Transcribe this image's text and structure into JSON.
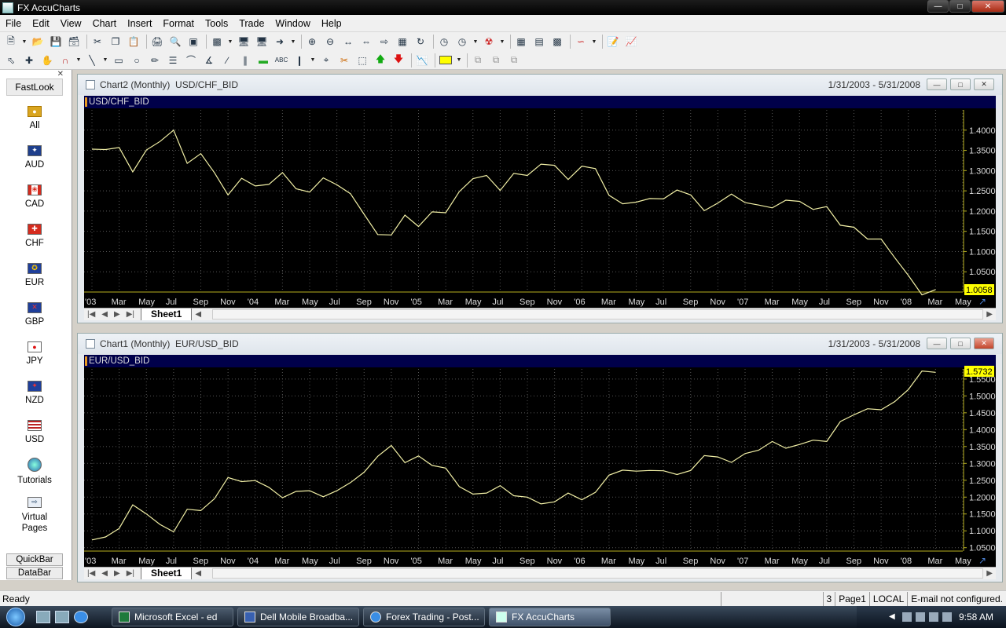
{
  "window": {
    "title": "FX AccuCharts"
  },
  "menu": [
    "File",
    "Edit",
    "View",
    "Chart",
    "Insert",
    "Format",
    "Tools",
    "Trade",
    "Window",
    "Help"
  ],
  "sidebar": {
    "title": "FastLook",
    "items": [
      {
        "label": "All",
        "icon": "coins-icon",
        "color": "#d9a520"
      },
      {
        "label": "AUD",
        "icon": "flag-aud-icon",
        "color": "#1e3f8c"
      },
      {
        "label": "CAD",
        "icon": "flag-cad-icon",
        "color": "#d52b1e"
      },
      {
        "label": "CHF",
        "icon": "flag-chf-icon",
        "color": "#d52b1e"
      },
      {
        "label": "EUR",
        "icon": "flag-eur-icon",
        "color": "#1f3f9a"
      },
      {
        "label": "GBP",
        "icon": "flag-gbp-icon",
        "color": "#1f3f9a"
      },
      {
        "label": "JPY",
        "icon": "flag-jpy-icon",
        "color": "#ffffff"
      },
      {
        "label": "NZD",
        "icon": "flag-nzd-icon",
        "color": "#1f3f9a"
      },
      {
        "label": "USD",
        "icon": "flag-usd-icon",
        "color": "#3c3b6e"
      },
      {
        "label": "Tutorials",
        "icon": "globe-icon",
        "color": "#2a6bb0"
      },
      {
        "label": "Virtual\nPages",
        "icon": "pages-icon",
        "color": "#4a7fb5"
      }
    ],
    "tabs": [
      "QuickBar",
      "DataBar"
    ]
  },
  "charts": {
    "chart2": {
      "window_title": "Chart2 (Monthly)  USD/CHF_BID",
      "range": "1/31/2003 - 5/31/2008",
      "label": "USD/CHF_BID",
      "last_value": "1.0058",
      "sheet": "Sheet1"
    },
    "chart1": {
      "window_title": "Chart1 (Monthly)  EUR/USD_BID",
      "range": "1/31/2003 - 5/31/2008",
      "label": "EUR/USD_BID",
      "last_value": "1.5732",
      "sheet": "Sheet1"
    }
  },
  "chart_data": [
    {
      "type": "line",
      "title": "USD/CHF_BID",
      "x_tick_labels": [
        "'03",
        "Mar",
        "May",
        "Jul",
        "Sep",
        "Nov",
        "'04",
        "Mar",
        "May",
        "Jul",
        "Sep",
        "Nov",
        "'05",
        "Mar",
        "May",
        "Jul",
        "Sep",
        "Nov",
        "'06",
        "Mar",
        "May",
        "Jul",
        "Sep",
        "Nov",
        "'07",
        "Mar",
        "May",
        "Jul",
        "Sep",
        "Nov",
        "'08",
        "Mar",
        "May"
      ],
      "y_tick_labels": [
        "1.4000",
        "1.3500",
        "1.3000",
        "1.2500",
        "1.2000",
        "1.1500",
        "1.1000",
        "1.0500"
      ],
      "ylim": [
        1.0,
        1.45
      ],
      "line_color": "#f2f0a6",
      "values": [
        1.353,
        1.352,
        1.357,
        1.297,
        1.351,
        1.372,
        1.4,
        1.318,
        1.342,
        1.295,
        1.24,
        1.281,
        1.262,
        1.266,
        1.295,
        1.255,
        1.247,
        1.282,
        1.265,
        1.243,
        1.192,
        1.142,
        1.141,
        1.19,
        1.162,
        1.198,
        1.196,
        1.248,
        1.28,
        1.288,
        1.251,
        1.293,
        1.288,
        1.316,
        1.313,
        1.278,
        1.311,
        1.305,
        1.239,
        1.218,
        1.222,
        1.231,
        1.23,
        1.252,
        1.24,
        1.201,
        1.22,
        1.242,
        1.221,
        1.215,
        1.208,
        1.227,
        1.224,
        1.204,
        1.211,
        1.165,
        1.16,
        1.131,
        1.131,
        1.085,
        1.041,
        0.993,
        1.006
      ],
      "last_value": 1.0058
    },
    {
      "type": "line",
      "title": "EUR/USD_BID",
      "x_tick_labels": [
        "'03",
        "Mar",
        "May",
        "Jul",
        "Sep",
        "Nov",
        "'04",
        "Mar",
        "May",
        "Jul",
        "Sep",
        "Nov",
        "'05",
        "Mar",
        "May",
        "Jul",
        "Sep",
        "Nov",
        "'06",
        "Mar",
        "May",
        "Jul",
        "Sep",
        "Nov",
        "'07",
        "Mar",
        "May",
        "Jul",
        "Sep",
        "Nov",
        "'08",
        "Mar",
        "May"
      ],
      "y_tick_labels": [
        "1.5500",
        "1.5000",
        "1.4500",
        "1.4000",
        "1.3500",
        "1.3000",
        "1.2500",
        "1.2000",
        "1.1500",
        "1.1000",
        "1.0500"
      ],
      "ylim": [
        1.04,
        1.58
      ],
      "line_color": "#f2f0a6",
      "values": [
        1.073,
        1.082,
        1.107,
        1.177,
        1.15,
        1.119,
        1.097,
        1.164,
        1.16,
        1.195,
        1.258,
        1.246,
        1.249,
        1.229,
        1.198,
        1.217,
        1.219,
        1.201,
        1.219,
        1.243,
        1.274,
        1.321,
        1.353,
        1.302,
        1.322,
        1.294,
        1.286,
        1.231,
        1.209,
        1.212,
        1.234,
        1.204,
        1.2,
        1.18,
        1.186,
        1.212,
        1.192,
        1.214,
        1.265,
        1.28,
        1.277,
        1.279,
        1.278,
        1.267,
        1.279,
        1.323,
        1.319,
        1.303,
        1.329,
        1.339,
        1.365,
        1.345,
        1.356,
        1.369,
        1.365,
        1.424,
        1.444,
        1.462,
        1.459,
        1.483,
        1.519,
        1.574,
        1.57
      ],
      "last_value": 1.5732
    }
  ],
  "statusbar": {
    "status": "Ready",
    "count": "3",
    "page": "Page1",
    "mode": "LOCAL",
    "email": "E-mail not configured."
  },
  "taskbar": {
    "tasks": [
      {
        "label": "Microsoft Excel - ed",
        "active": false
      },
      {
        "label": "Dell Mobile Broadba...",
        "active": false
      },
      {
        "label": "Forex Trading - Post...",
        "active": false
      },
      {
        "label": "FX AccuCharts",
        "active": true
      }
    ],
    "clock": "9:58 AM"
  }
}
